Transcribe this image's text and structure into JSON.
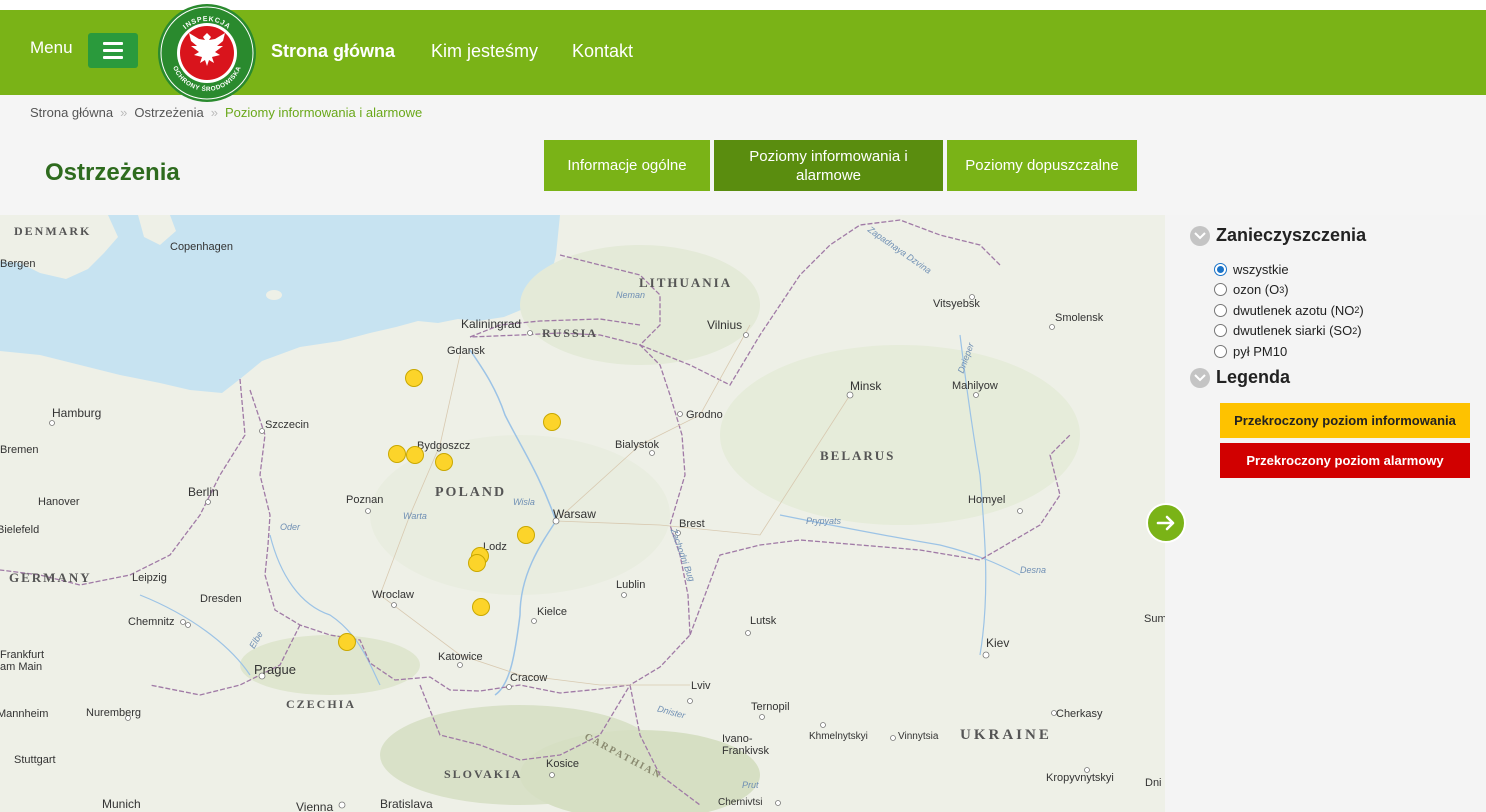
{
  "header": {
    "menu_label": "Menu",
    "logo": {
      "top_text": "INSPEKCJA",
      "bottom_text": "OCHRONY ŚRODOWISKA"
    },
    "nav": [
      {
        "label": "Strona główna",
        "active": true
      },
      {
        "label": "Kim jesteśmy"
      },
      {
        "label": "Kontakt"
      }
    ]
  },
  "breadcrumb": [
    "Strona główna",
    "Ostrzeżenia",
    "Poziomy informowania i alarmowe"
  ],
  "breadcrumb_sep": "»",
  "page_title": "Ostrzeżenia",
  "tabs": [
    {
      "label": "Informacje ogólne"
    },
    {
      "label": "Poziomy informowania i alarmowe",
      "active": true
    },
    {
      "label": "Poziomy dopuszczalne"
    }
  ],
  "map": {
    "countries": [
      "DENMARK",
      "LITHUANIA",
      "RUSSIA",
      "BELARUS",
      "POLAND",
      "GERMANY",
      "CZECHIA",
      "SLOVAKIA",
      "UKRAINE",
      "CARPATHIAN"
    ],
    "cities": [
      "Copenhagen",
      "Kaliningrad",
      "Gdansk",
      "Vilnius",
      "Vitsyebsk",
      "Smolensk",
      "Hamburg",
      "Szczecin",
      "Bydgoszcz",
      "Bialystok",
      "Grodno",
      "Minsk",
      "Mahilyow",
      "Bremen",
      "Hanover",
      "Berlin",
      "Poznan",
      "Warsaw",
      "Brest",
      "Homyel",
      "Bielefeld",
      "Lodz",
      "Leipzig",
      "Dresden",
      "Wroclaw",
      "Lublin",
      "Chemnitz",
      "Kielce",
      "Lutsk",
      "Kiev",
      "Prague",
      "Katowice",
      "Frankfurt am Main",
      "Cracow",
      "Lviv",
      "Ternopil",
      "Mannheim",
      "Nuremberg",
      "Ivano-Frankivsk",
      "Khmelnytskyi",
      "Vinnytsia",
      "Cherkasy",
      "Stuttgart",
      "Kosice",
      "Kropyvnytskyi",
      "Munich",
      "Vienna",
      "Bratislava",
      "Chernivtsi",
      "Sum",
      "Dni",
      "Bergen"
    ],
    "rivers": [
      "Neman",
      "Zapadnaya Dzvina",
      "Dnieper",
      "Wisla",
      "Warta",
      "Oder",
      "Prypyats",
      "Desna",
      "Zachodni Bug",
      "Elbe",
      "Dnister",
      "Prut"
    ],
    "stations_count": 11
  },
  "panel": {
    "pollutants_title": "Zanieczyszczenia",
    "options": [
      {
        "label": "wszystkie",
        "checked": true
      },
      {
        "label": "ozon (O",
        "sub": "3",
        "tail": ")"
      },
      {
        "label": "dwutlenek azotu (NO",
        "sub": "2",
        "tail": ")"
      },
      {
        "label": "dwutlenek siarki (SO",
        "sub": "2",
        "tail": ")"
      },
      {
        "label": "pył PM10",
        "sub": "",
        "tail": ""
      }
    ],
    "legend_title": "Legenda",
    "legend": [
      {
        "label": "Przekroczony poziom informowania",
        "color": "#fec200"
      },
      {
        "label": "Przekroczony poziom alarmowy",
        "color": "#d10000"
      }
    ]
  },
  "colors": {
    "brand_green": "#7ab317",
    "active_tab": "#5a8d0f",
    "title_green": "#2e6b1e",
    "station_yellow": "#fcd42a"
  }
}
